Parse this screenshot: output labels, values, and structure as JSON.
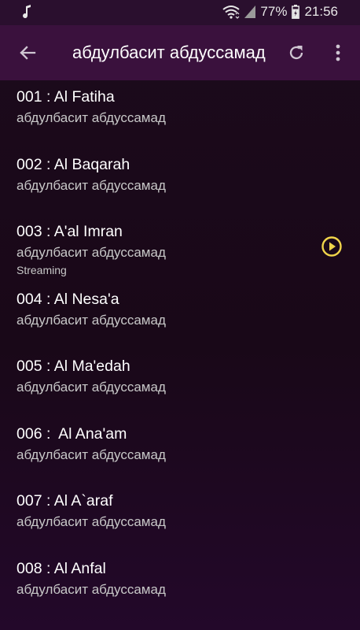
{
  "status_bar": {
    "battery": "77%",
    "time": "21:56",
    "left_icon": "music-note-icon",
    "icons": [
      "wifi-icon",
      "signal-icon",
      "battery-icon"
    ]
  },
  "app_bar": {
    "title": "абдулбасит абдуссамад",
    "back_icon": "arrow-back-icon",
    "refresh_icon": "refresh-icon",
    "menu_icon": "more-vert-icon"
  },
  "colors": {
    "app_bar": "#3a113d",
    "status_bar": "#2a0f2e",
    "background": "#1c0a1c",
    "accent": "#f0d44a"
  },
  "tracks": [
    {
      "title": "001 : Al Fatiha",
      "artist": "абдулбасит абдуссамад",
      "status": ""
    },
    {
      "title": "002 : Al Baqarah",
      "artist": "абдулбасит абдуссамад",
      "status": ""
    },
    {
      "title": "003 : A'al Imran",
      "artist": "абдулбасит абдуссамад",
      "status": "Streaming",
      "playing": true
    },
    {
      "title": "004 : Al Nesa'a",
      "artist": "абдулбасит абдуссамад",
      "status": ""
    },
    {
      "title": "005 : Al Ma'edah",
      "artist": "абдулбасит абдуссамад",
      "status": ""
    },
    {
      "title": "006 :  Al Ana'am",
      "artist": "абдулбасит абдуссамад",
      "status": ""
    },
    {
      "title": "007 : Al A`araf",
      "artist": "абдулбасит абдуссамад",
      "status": ""
    },
    {
      "title": "008 : Al Anfal",
      "artist": "абдулбасит абдуссамад",
      "status": ""
    }
  ]
}
